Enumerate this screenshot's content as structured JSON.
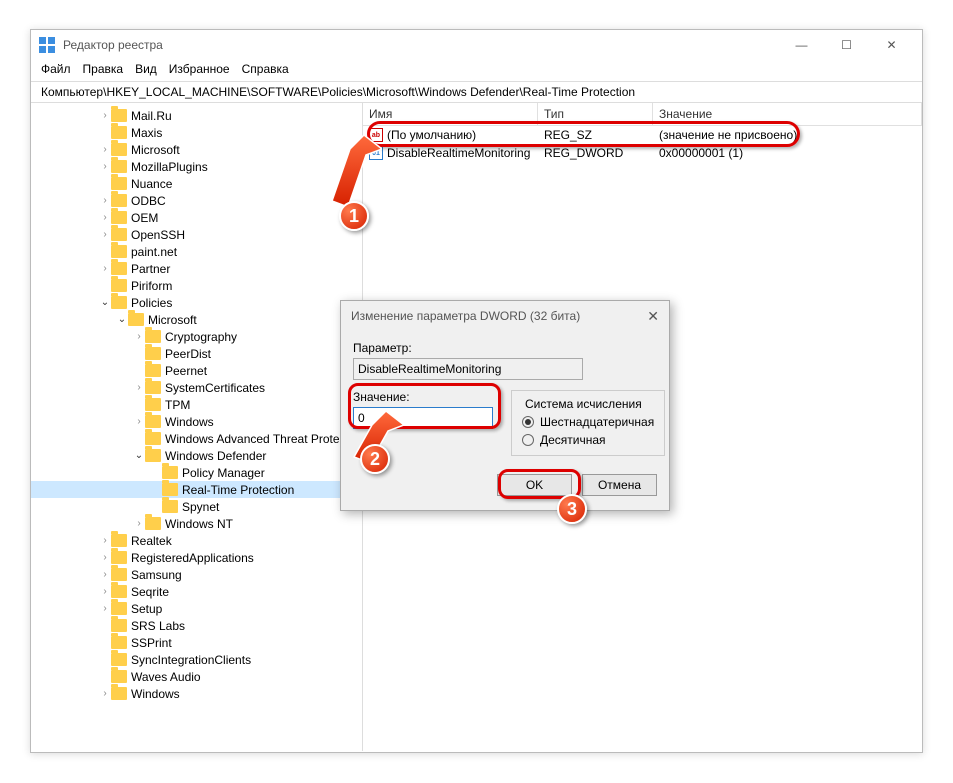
{
  "window": {
    "title": "Редактор реестра",
    "controls": {
      "min": "—",
      "max": "☐",
      "close": "✕"
    }
  },
  "menubar": [
    "Файл",
    "Правка",
    "Вид",
    "Избранное",
    "Справка"
  ],
  "addressbar": "Компьютер\\HKEY_LOCAL_MACHINE\\SOFTWARE\\Policies\\Microsoft\\Windows Defender\\Real-Time Protection",
  "tree": [
    {
      "d": 4,
      "c": ">",
      "l": "Mail.Ru"
    },
    {
      "d": 4,
      "c": "",
      "l": "Maxis"
    },
    {
      "d": 4,
      "c": ">",
      "l": "Microsoft"
    },
    {
      "d": 4,
      "c": ">",
      "l": "MozillaPlugins"
    },
    {
      "d": 4,
      "c": "",
      "l": "Nuance"
    },
    {
      "d": 4,
      "c": ">",
      "l": "ODBC"
    },
    {
      "d": 4,
      "c": ">",
      "l": "OEM"
    },
    {
      "d": 4,
      "c": ">",
      "l": "OpenSSH"
    },
    {
      "d": 4,
      "c": "",
      "l": "paint.net"
    },
    {
      "d": 4,
      "c": ">",
      "l": "Partner"
    },
    {
      "d": 4,
      "c": "",
      "l": "Piriform"
    },
    {
      "d": 4,
      "c": "v",
      "l": "Policies"
    },
    {
      "d": 5,
      "c": "v",
      "l": "Microsoft"
    },
    {
      "d": 6,
      "c": ">",
      "l": "Cryptography"
    },
    {
      "d": 6,
      "c": "",
      "l": "PeerDist"
    },
    {
      "d": 6,
      "c": "",
      "l": "Peernet"
    },
    {
      "d": 6,
      "c": ">",
      "l": "SystemCertificates"
    },
    {
      "d": 6,
      "c": "",
      "l": "TPM"
    },
    {
      "d": 6,
      "c": ">",
      "l": "Windows"
    },
    {
      "d": 6,
      "c": "",
      "l": "Windows Advanced Threat Protect"
    },
    {
      "d": 6,
      "c": "v",
      "l": "Windows Defender"
    },
    {
      "d": 7,
      "c": "",
      "l": "Policy Manager"
    },
    {
      "d": 7,
      "c": "",
      "l": "Real-Time Protection",
      "sel": true
    },
    {
      "d": 7,
      "c": "",
      "l": "Spynet"
    },
    {
      "d": 6,
      "c": ">",
      "l": "Windows NT"
    },
    {
      "d": 4,
      "c": ">",
      "l": "Realtek"
    },
    {
      "d": 4,
      "c": ">",
      "l": "RegisteredApplications"
    },
    {
      "d": 4,
      "c": ">",
      "l": "Samsung"
    },
    {
      "d": 4,
      "c": ">",
      "l": "Seqrite"
    },
    {
      "d": 4,
      "c": ">",
      "l": "Setup"
    },
    {
      "d": 4,
      "c": "",
      "l": "SRS Labs"
    },
    {
      "d": 4,
      "c": "",
      "l": "SSPrint"
    },
    {
      "d": 4,
      "c": "",
      "l": "SyncIntegrationClients"
    },
    {
      "d": 4,
      "c": "",
      "l": "Waves Audio"
    },
    {
      "d": 4,
      "c": ">",
      "l": "Windows"
    }
  ],
  "list": {
    "headers": {
      "name": "Имя",
      "type": "Тип",
      "val": "Значение"
    },
    "rows": [
      {
        "icon": "sz",
        "name": "(По умолчанию)",
        "type": "REG_SZ",
        "val": "(значение не присвоено)"
      },
      {
        "icon": "dw",
        "name": "DisableRealtimeMonitoring",
        "type": "REG_DWORD",
        "val": "0x00000001 (1)"
      }
    ]
  },
  "dialog": {
    "title": "Изменение параметра DWORD (32 бита)",
    "param_label": "Параметр:",
    "param_value": "DisableRealtimeMonitoring",
    "value_label": "Значение:",
    "value_input": "0",
    "base_label": "Система исчисления",
    "base_hex": "Шестнадцатеричная",
    "base_dec": "Десятичная",
    "ok": "OK",
    "cancel": "Отмена"
  },
  "badges": {
    "b1": "1",
    "b2": "2",
    "b3": "3"
  }
}
